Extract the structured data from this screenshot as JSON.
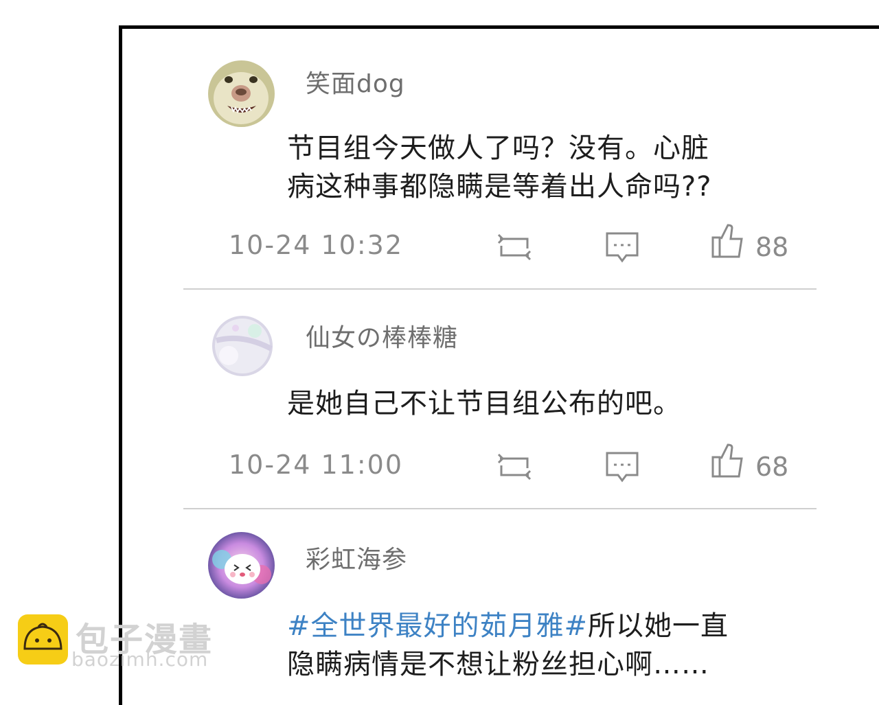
{
  "comments": [
    {
      "username": "笑面dog",
      "text_lines": [
        "节目组今天做人了吗？没有。心脏",
        "病这种事都隐瞒是等着出人命吗??"
      ],
      "time": "10-24 10:32",
      "likes": "88",
      "avatar_icon": "dog-face-avatar"
    },
    {
      "username": "仙女の棒棒糖",
      "text_lines": [
        "是她自己不让节目组公布的吧。"
      ],
      "time": "10-24 11:00",
      "likes": "68",
      "avatar_icon": "lollipop-avatar"
    },
    {
      "username": "彩虹海参",
      "hashtag": "#全世界最好的茹月雅#",
      "text_line1_rest": "所以她一直",
      "text_line2": "隐瞒病情是不想让粉丝担心啊……",
      "avatar_icon": "cute-blob-avatar"
    }
  ],
  "actions": {
    "repost_icon": "repost-icon",
    "comment_icon": "comment-icon",
    "like_icon": "thumbs-up-icon"
  },
  "watermark": {
    "title": "包子漫畫",
    "url": "baozimh.com",
    "logo_icon": "bun-logo-icon"
  },
  "colors": {
    "hashtag": "#3d82c4",
    "meta_gray": "#8a8a8a",
    "logo_yellow": "#f6cd16"
  }
}
